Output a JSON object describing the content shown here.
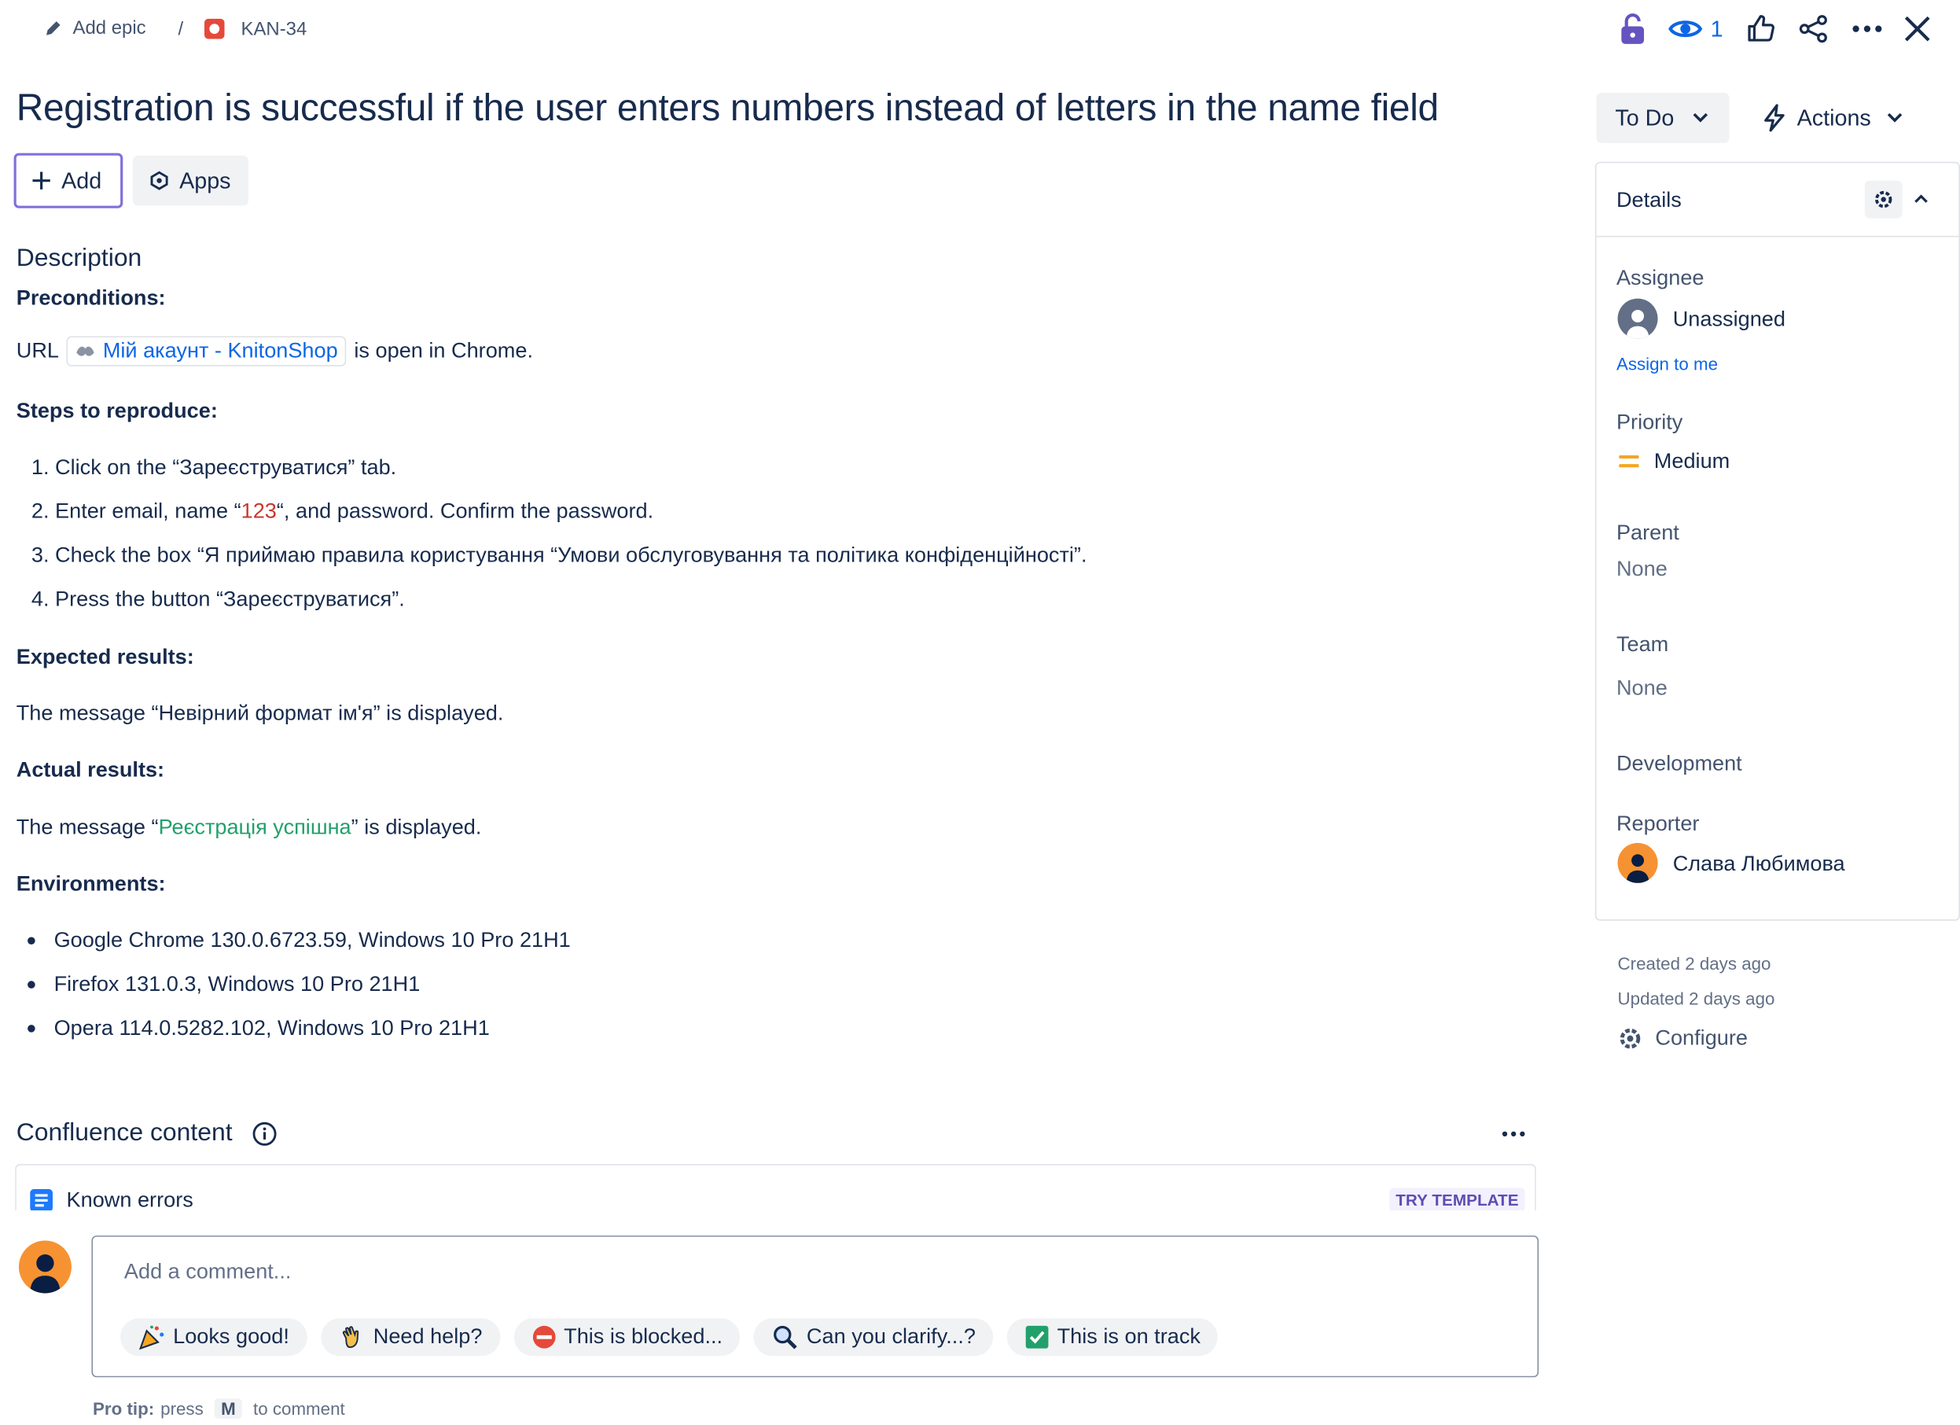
{
  "breadcrumb": {
    "add_epic": "Add epic",
    "separator": "/",
    "issue_key": "KAN-34"
  },
  "top_actions": {
    "watch_count": "1"
  },
  "issue": {
    "title": "Registration is successful if the user enters numbers instead of letters in the name field"
  },
  "buttons": {
    "add": "Add",
    "apps": "Apps",
    "status": "To Do",
    "actions": "Actions"
  },
  "description": {
    "heading": "Description",
    "preconditions_label": "Preconditions:",
    "url_prefix": "URL",
    "link_text": "Мій акаунт - KnitonShop",
    "url_suffix": "is open in Chrome.",
    "steps_label": "Steps to reproduce:",
    "step1": "Click on the “Зареєструватися” tab.",
    "step2_a": "Enter email, name “",
    "step2_b": "123",
    "step2_c": "“, and password.  Confirm the password.",
    "step3": "Check the box “Я приймаю правила користування “Умови обслуговування та політика конфіденційності”.",
    "step4": "Press the button “Зареєструватися”.",
    "expected_label": "Expected results:",
    "expected_text": "The message “Невірний формат ім'я” is displayed.",
    "actual_label": "Actual results:",
    "actual_a": "The message “",
    "actual_b": "Реєстрація успішна",
    "actual_c": "” is displayed.",
    "env_label": "Environments:",
    "env": [
      "Google Chrome 130.0.6723.59, Windows 10 Pro 21H1",
      "Firefox 131.0.3, Windows 10 Pro 21H1",
      "Opera 114.0.5282.102, Windows 10 Pro 21H1"
    ]
  },
  "confluence": {
    "heading": "Confluence content",
    "item": "Known errors",
    "try_template": "TRY TEMPLATE"
  },
  "comment": {
    "placeholder": "Add a comment...",
    "chips": [
      "Looks good!",
      "Need help?",
      "This is blocked...",
      "Can you clarify...?",
      "This is on track"
    ],
    "protip_label": "Pro tip:",
    "protip_press": "press",
    "protip_key": "M",
    "protip_suffix": "to comment"
  },
  "details": {
    "heading": "Details",
    "assignee_label": "Assignee",
    "assignee_value": "Unassigned",
    "assign_to_me": "Assign to me",
    "priority_label": "Priority",
    "priority_value": "Medium",
    "parent_label": "Parent",
    "parent_value": "None",
    "team_label": "Team",
    "team_value": "None",
    "development_label": "Development",
    "reporter_label": "Reporter",
    "reporter_value": "Слава Любимова"
  },
  "meta": {
    "created": "Created 2 days ago",
    "updated": "Updated 2 days ago",
    "configure": "Configure"
  },
  "colors": {
    "accent": "#0c66e4",
    "priority_medium": "#f5a623",
    "avatar_orange": "#f79232",
    "lock_purple": "#6554c0"
  }
}
